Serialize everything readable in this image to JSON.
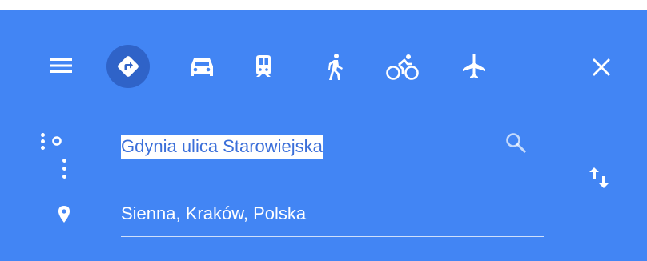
{
  "toolbar": {
    "menu_icon": "menu-icon",
    "modes": [
      {
        "name": "best",
        "icon": "directions-icon",
        "selected": true
      },
      {
        "name": "driving",
        "icon": "car-icon",
        "selected": false
      },
      {
        "name": "transit",
        "icon": "train-icon",
        "selected": false
      },
      {
        "name": "walking",
        "icon": "walk-icon",
        "selected": false
      },
      {
        "name": "cycling",
        "icon": "bicycle-icon",
        "selected": false
      },
      {
        "name": "flights",
        "icon": "airplane-icon",
        "selected": false
      }
    ],
    "close_icon": "close-icon"
  },
  "route": {
    "origin": {
      "value": "Gdynia ulica Starowiejska",
      "selected_text": true
    },
    "destination": {
      "value": "Sienna, Kraków, Polska"
    },
    "search_icon": "search-icon",
    "swap_icon": "swap-vertical-icon"
  },
  "colors": {
    "panel_background": "#4285f4",
    "selected_mode_background": "#2f63c8",
    "foreground": "#ffffff",
    "selection_highlight": "#ffffff",
    "selected_text_color": "#3b6fd9"
  }
}
